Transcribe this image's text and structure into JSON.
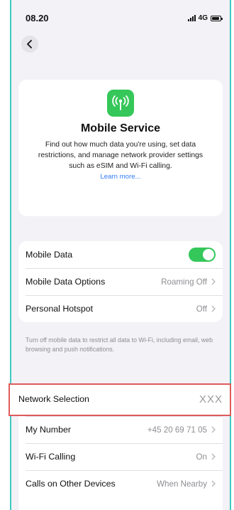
{
  "status_bar": {
    "time": "08.20",
    "network": "4G"
  },
  "info_card": {
    "title": "Mobile Service",
    "description": "Find out how much data you're using, set data restrictions, and manage network provider settings such as eSIM and Wi-Fi calling.",
    "link": "Learn more..."
  },
  "data_group": {
    "mobile_data": {
      "label": "Mobile Data",
      "enabled": true
    },
    "data_options": {
      "label": "Mobile Data Options",
      "value": "Roaming Off"
    },
    "hotspot": {
      "label": "Personal Hotspot",
      "value": "Off"
    }
  },
  "note": "Turn off mobile data to restrict all data to Wi-Fi, including email, web browsing and push notifications.",
  "network_group": {
    "network_selection": {
      "label": "Network Selection",
      "value": "XXX"
    },
    "my_number": {
      "label": "My Number",
      "value": "+45 20 69 71 05"
    },
    "wifi_calling": {
      "label": "Wi-Fi Calling",
      "value": "On"
    },
    "other_devices": {
      "label": "Calls on Other Devices",
      "value": "When Nearby"
    }
  },
  "colors": {
    "accent_green": "#34c759",
    "link_blue": "#2f7cf6",
    "highlight_red": "#e05a5a"
  }
}
